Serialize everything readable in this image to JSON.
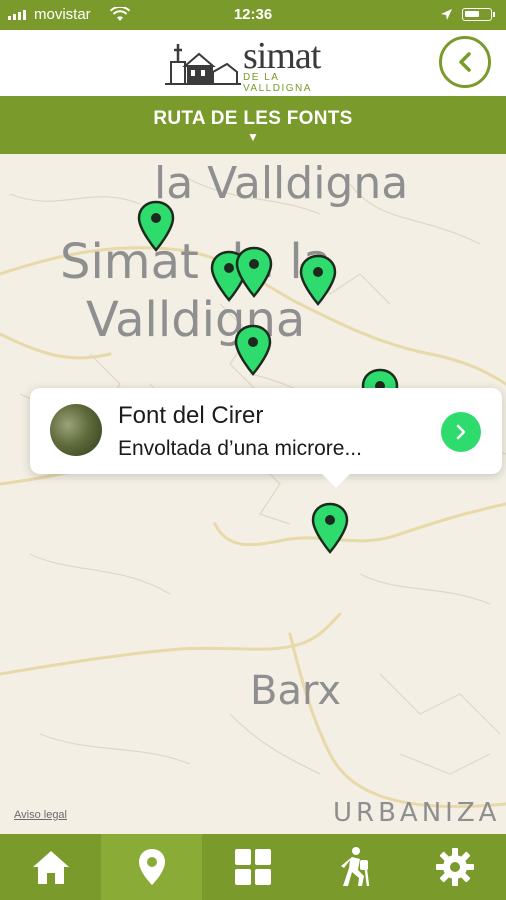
{
  "status_bar": {
    "carrier": "movistar",
    "time": "12:36"
  },
  "header": {
    "logo_name": "simat",
    "logo_sub": "DE LA VALLDIGNA",
    "back_icon": "chevron-left-icon"
  },
  "route": {
    "title": "RUTA DE LES FONTS"
  },
  "map": {
    "labels": {
      "valldigna_top": "la Valldigna",
      "simat_line1": "Simat de la",
      "simat_line2": "Valldigna",
      "barx": "Barx",
      "urbaniza": "URBANIZA"
    },
    "legal": "Aviso legal",
    "pin_count": 8
  },
  "callout": {
    "title": "Font del Cirer",
    "subtitle": "Envoltada d’una microre..."
  },
  "tabbar": {
    "items": [
      "home-icon",
      "map-pin-icon",
      "grid-icon",
      "hiking-icon",
      "gear-icon"
    ],
    "active": "map-pin-icon"
  },
  "colors": {
    "brand_green": "#7a9a2c",
    "pin_green": "#2ddc6c"
  }
}
